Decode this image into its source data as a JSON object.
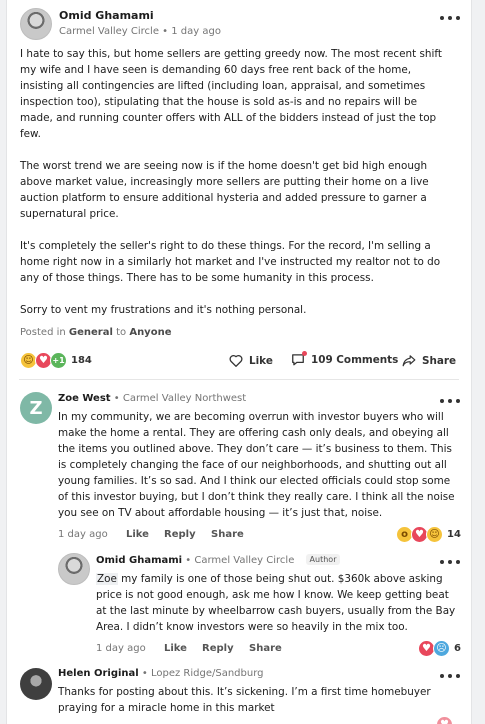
{
  "post": {
    "author": "Omid Ghamami",
    "neighborhood": "Carmel Valley Circle",
    "time": "1 day ago",
    "paragraphs": [
      "I hate to say this, but home sellers are getting greedy now.  The most recent shift my wife and I have seen is demanding 60 days free rent back of the home, insisting all contingencies are lifted (including loan, appraisal, and sometimes inspection too), stipulating that the house is sold as-is and no repairs will be made, and running counter offers with ALL of the bidders instead of just the top few.",
      "The worst trend we are seeing now is if the home doesn't get bid high enough above market value, increasingly more sellers are putting their home on a live auction platform to ensure additional hysteria and added pressure to garner a supernatural price.",
      "It's completely the seller's right to do these things.  For the record, I'm selling a home right now in a similarly hot market and I've instructed my realtor not to do any of those things.  There has to be some humanity in this process.",
      "Sorry to vent my frustrations and it's nothing personal."
    ],
    "posted_in_prefix": "Posted in",
    "category": "General",
    "to_word": "to",
    "audience": "Anyone",
    "reaction_count": "184",
    "like_label": "Like",
    "comments_label": "109 Comments",
    "share_label": "Share"
  },
  "comments": [
    {
      "author": "Zoe West",
      "neighborhood": "Carmel Valley Northwest",
      "avatar_letter": "Z",
      "text": "In my community, we are becoming overrun with investor buyers who will make the home a rental. They are offering cash only deals, and obeying all the items you outlined above. They don’t care — it’s business to them. This is completely changing the face of our neighborhoods, and shutting out all young families. It’s so sad. And I think our elected officials could stop some of this investor buying, but I don’t think they really care. I think all the noise you see on TV about affordable housing — it’s just that, noise.",
      "time": "1 day ago",
      "like": "Like",
      "reply": "Reply",
      "share": "Share",
      "reaction_count": "14"
    },
    {
      "author": "Omid Ghamami",
      "neighborhood": "Carmel Valley Circle",
      "badge": "Author",
      "mention": "Zoe",
      "text": " my family is one of those being shut out.  $360k above asking price is not good enough, ask me how I know.  We keep getting beat at the last minute by wheelbarrow cash buyers, usually from the Bay Area. I didn’t know investors were so heavily in the mix too.",
      "time": "1 day ago",
      "like": "Like",
      "reply": "Reply",
      "share": "Share",
      "reaction_count": "6"
    },
    {
      "author": "Helen Original",
      "neighborhood": "Lopez Ridge/Sandburg",
      "text": "Thanks for posting about this. It’s sickening. I’m a first time homebuyer praying for a miracle home in this market"
    }
  ],
  "meta_separator": "•",
  "colors": {
    "haha": "#f5c33b",
    "love": "#e8475b",
    "plus_one": "#5bb55b",
    "wow": "#f5c33b",
    "sad": "#4ea8de"
  }
}
